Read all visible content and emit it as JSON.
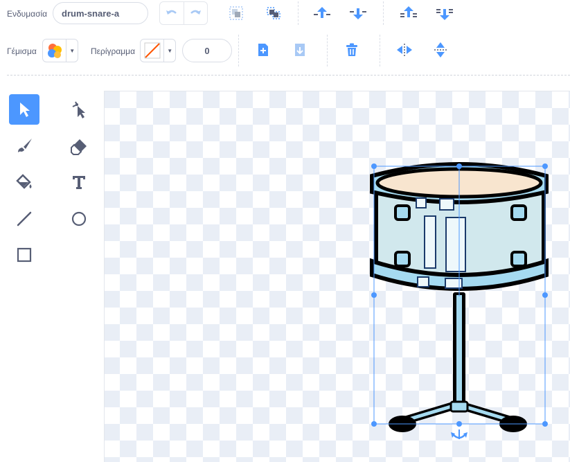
{
  "costume": {
    "label": "Ενδυμασία",
    "name": "drum-snare-a"
  },
  "fill": {
    "label": "Γέμισμα"
  },
  "outline": {
    "label": "Περίγραμμα",
    "width": "0"
  },
  "toolbar": {
    "undo_icon": "undo-icon",
    "redo_icon": "redo-icon",
    "group_icon": "group-icon",
    "ungroup_icon": "ungroup-icon",
    "forward_icon": "forward-icon",
    "backward_icon": "backward-icon",
    "front_icon": "front-icon",
    "back_icon": "back-icon",
    "copy_icon": "copy-icon",
    "paste_icon": "paste-icon",
    "delete_icon": "trash-icon",
    "flip_h_icon": "flip-horizontal-icon",
    "flip_v_icon": "flip-vertical-icon"
  },
  "tools": [
    "select",
    "reshape",
    "brush",
    "eraser",
    "fill",
    "text",
    "line",
    "circle",
    "rectangle"
  ],
  "colors": {
    "accent": "#4c97ff",
    "toolbar_icon": "#4c97ff",
    "text": "#575e75",
    "drum_fill": "#d1e8ed",
    "drum_head": "#f8e5cf",
    "drum_rim": "#a5daf0",
    "outline": "#000000"
  }
}
